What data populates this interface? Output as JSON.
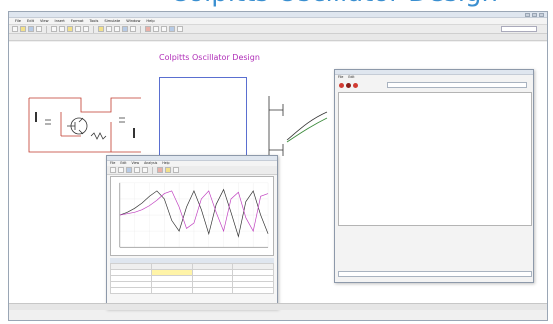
{
  "banner": {
    "cut_text": "Colpitts Oscillator Design"
  },
  "app": {
    "title": "",
    "menu": [
      "File",
      "Edit",
      "View",
      "Insert",
      "Format",
      "Tools",
      "Simulate",
      "Window",
      "Help"
    ],
    "tabs": [],
    "accent_color": "#b02eb8"
  },
  "diagram": {
    "title": "Colpitts Oscillator Design",
    "notes": [],
    "labels": []
  },
  "simulation": {
    "title": "",
    "menu": [
      "File",
      "Edit",
      "View",
      "Analysis",
      "Help"
    ],
    "chart_data": {
      "type": "line",
      "title": "",
      "xlabel": "",
      "ylabel": "",
      "x": [
        0,
        1,
        2,
        3,
        4,
        5,
        6,
        7,
        8,
        9,
        10,
        11,
        12,
        13,
        14,
        15,
        16,
        17,
        18,
        19,
        20
      ],
      "ylim": [
        -1.2,
        1.2
      ],
      "grid": true,
      "series": [
        {
          "color": "#333333",
          "values": [
            0,
            0.1,
            0.25,
            0.45,
            0.7,
            0.9,
            0.6,
            -0.2,
            -0.6,
            0.3,
            0.9,
            0.2,
            -0.7,
            0.4,
            0.95,
            0.1,
            -0.8,
            0.5,
            0.9,
            0.0,
            -0.7
          ]
        },
        {
          "color": "#c040c0",
          "values": [
            0,
            0.05,
            0.1,
            0.2,
            0.35,
            0.55,
            0.8,
            0.9,
            0.3,
            -0.5,
            -0.3,
            0.6,
            0.9,
            0.1,
            -0.6,
            0.6,
            0.85,
            -0.1,
            -0.6,
            0.7,
            0.8
          ]
        }
      ]
    },
    "table_title": "",
    "table_headers": [],
    "table_rows": [],
    "tabs": []
  },
  "properties": {
    "title": "",
    "menu": [
      "File",
      "Edit"
    ],
    "field_value": "",
    "sections": [],
    "combo_value": "",
    "footer": ""
  },
  "status": {
    "left": "",
    "right": ""
  }
}
